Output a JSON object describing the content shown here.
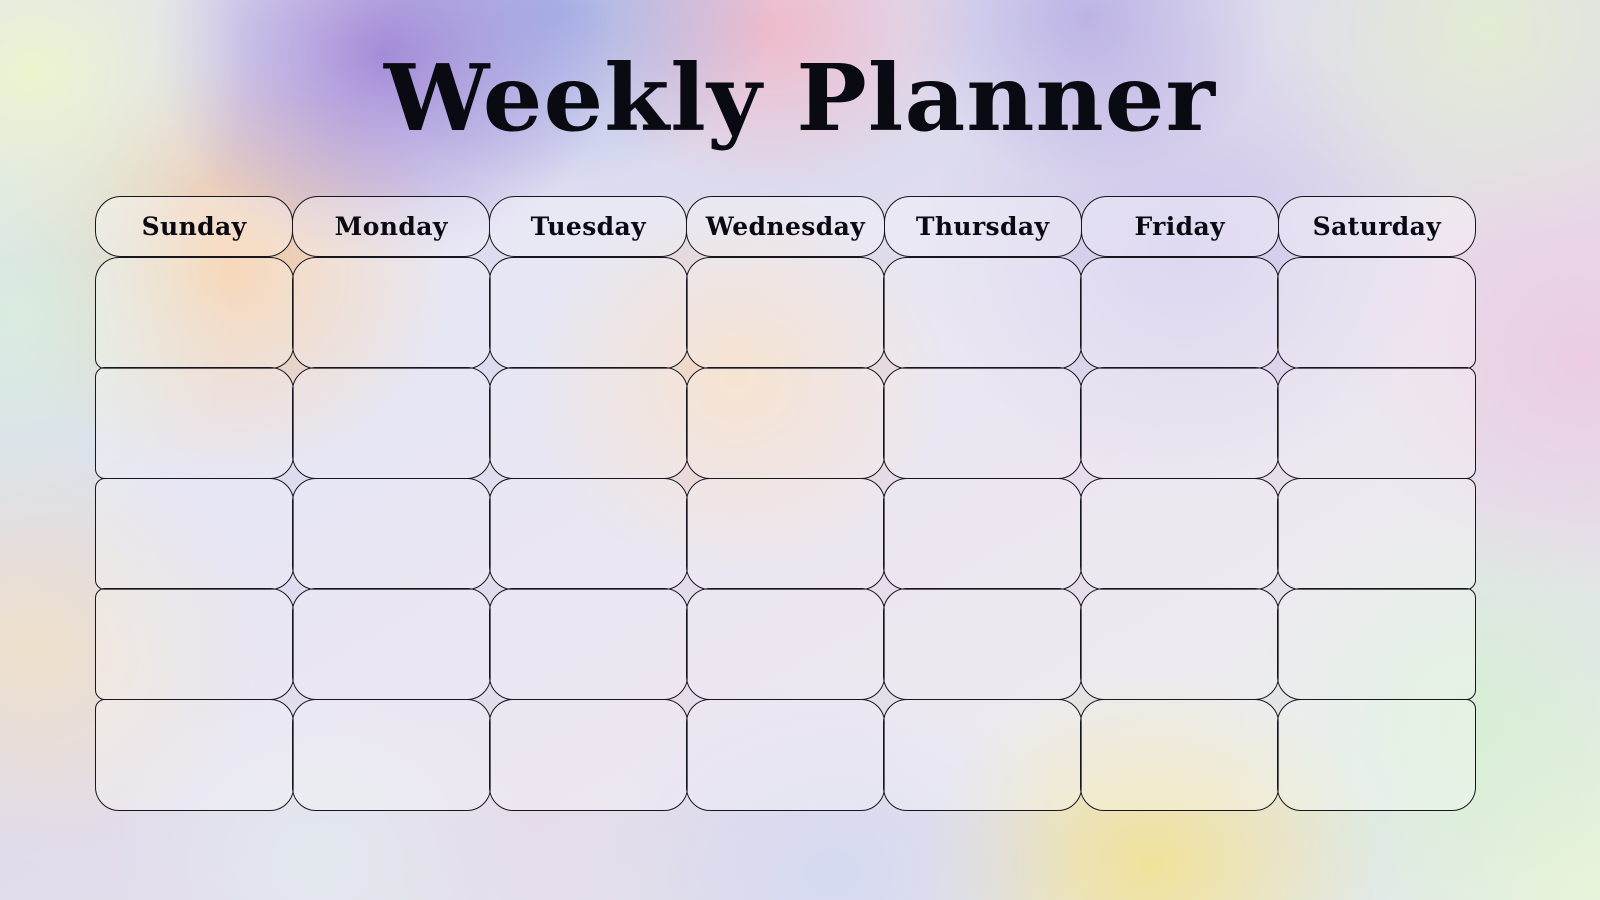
{
  "page": {
    "title": "Weekly Planner",
    "background_style": "pastel-mesh-gradient",
    "accent_colors": {
      "ink": "#16161e",
      "mint": "#ecf6ce",
      "purple": "#9678d2",
      "pink": "#f5afbe",
      "peach": "#f8c48c",
      "gold": "#f4e28c",
      "lilac": "#dcdcf0"
    }
  },
  "planner": {
    "day_headers": [
      {
        "label": "Sunday"
      },
      {
        "label": "Monday"
      },
      {
        "label": "Tuesday"
      },
      {
        "label": "Wednesday"
      },
      {
        "label": "Thursday"
      },
      {
        "label": "Friday"
      },
      {
        "label": "Saturday"
      }
    ],
    "row_count": 5,
    "column_count": 7,
    "rows": [
      {
        "cells": [
          "",
          "",
          "",
          "",
          "",
          "",
          ""
        ]
      },
      {
        "cells": [
          "",
          "",
          "",
          "",
          "",
          "",
          ""
        ]
      },
      {
        "cells": [
          "",
          "",
          "",
          "",
          "",
          "",
          ""
        ]
      },
      {
        "cells": [
          "",
          "",
          "",
          "",
          "",
          "",
          ""
        ]
      },
      {
        "cells": [
          "",
          "",
          "",
          "",
          "",
          "",
          ""
        ]
      }
    ]
  }
}
